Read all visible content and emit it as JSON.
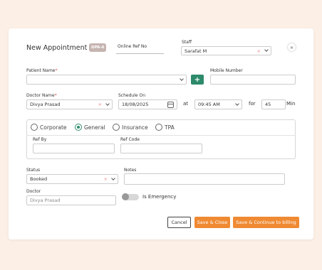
{
  "header": {
    "title": "New Appointment",
    "badge": "DPA-6",
    "online_ref_label": "Online Ref No",
    "staff_label": "Staff",
    "staff_value": "Sarafat M",
    "close_label": "×"
  },
  "patient": {
    "name_label": "Patient Name",
    "required_mark": "*",
    "add_label": "+",
    "mobile_label": "Mobile Number"
  },
  "doctor": {
    "name_label": "Doctor Name",
    "value": "Divya Prasad"
  },
  "schedule": {
    "label": "Schedule On",
    "date": "18/08/2025",
    "at_label": "at",
    "time": "09:45 AM",
    "for_label": "for",
    "duration": "45",
    "unit": "Min"
  },
  "payer": {
    "options": [
      "Corporate",
      "General",
      "Insurance",
      "TPA"
    ],
    "selected": "General",
    "ref_by_label": "Ref By",
    "ref_code_label": "Ref Code"
  },
  "status": {
    "label": "Status",
    "value": "Booked"
  },
  "notes": {
    "label": "Notes"
  },
  "doctor2": {
    "label": "Doctor",
    "placeholder": "Divya  Prasad"
  },
  "emergency": {
    "label": "Is Emergency",
    "on": false
  },
  "actions": {
    "cancel": "Cancel",
    "save_close": "Save & Close",
    "save_continue": "Save & Continue to billing"
  },
  "colors": {
    "accent_green": "#2d8a6a",
    "accent_orange": "#ef8a33",
    "background": "#fcefe6"
  }
}
